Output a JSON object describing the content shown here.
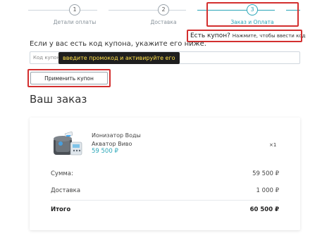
{
  "stepper": {
    "steps": [
      {
        "number": "1",
        "label": "Детали оплаты"
      },
      {
        "number": "2",
        "label": "Доставка"
      },
      {
        "number": "3",
        "label": "Заказ и Оплата"
      }
    ]
  },
  "coupon": {
    "hint_title": "Есть купон?",
    "hint_link": "Нажмите, чтобы ввести код",
    "description": "Если у вас есть код купона, укажите его ниже.",
    "input_placeholder": "Код купона",
    "tooltip": "введите промокод и активируйте его",
    "apply_label": "Применить купон"
  },
  "order": {
    "title": "Ваш заказ",
    "product": {
      "name_line1": "Ионизатор Воды",
      "name_line2": "Акватор Виво",
      "price": "59 500 ₽",
      "quantity": "×1"
    },
    "sum_label": "Сумма:",
    "sum_value": "59 500 ₽",
    "delivery_label": "Доставка",
    "delivery_value": "1 000 ₽",
    "total_label": "Итого",
    "total_value": "60 500 ₽"
  },
  "colors": {
    "accent": "#2aa6b8",
    "highlight": "#d32f2f",
    "tooltip_text": "#ffe14a"
  }
}
